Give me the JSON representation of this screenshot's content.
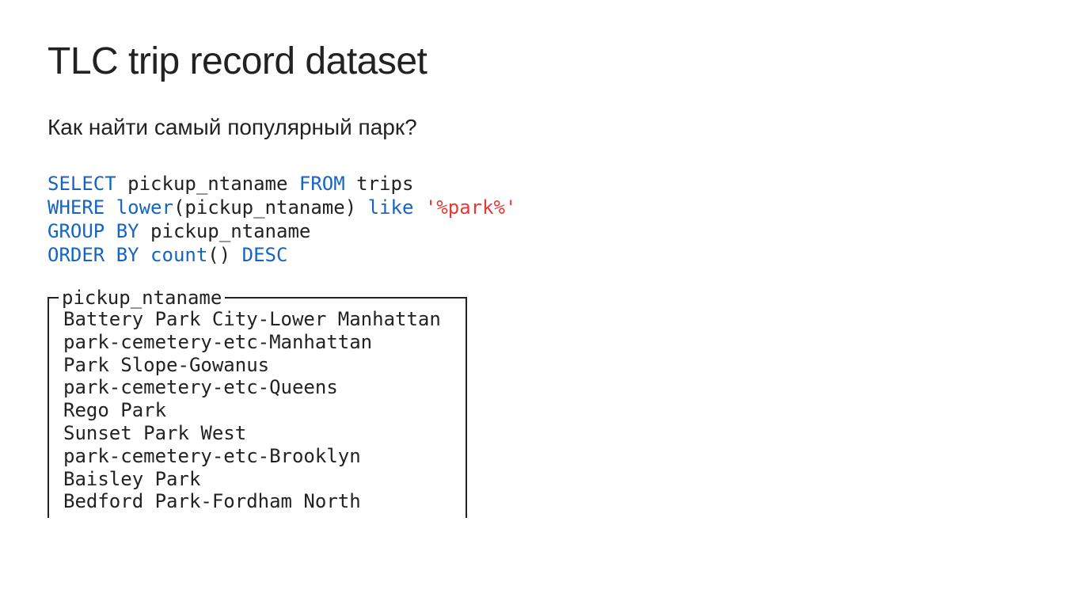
{
  "title": "TLC trip record dataset",
  "subtitle": "Как найти самый популярный парк?",
  "sql": {
    "select": "SELECT",
    "col": "pickup_ntaname",
    "from": "FROM",
    "table": "trips",
    "where": "WHERE",
    "lower": "lower",
    "arg": "(pickup_ntaname)",
    "like": "like",
    "pattern": "'%park%'",
    "groupby": "GROUP BY",
    "groupcol": "pickup_ntaname",
    "orderby": "ORDER BY",
    "count": "count",
    "parens": "()",
    "desc": "DESC"
  },
  "output": {
    "header": "pickup_ntaname",
    "rows": [
      "Battery Park City-Lower Manhattan",
      "park-cemetery-etc-Manhattan",
      "Park Slope-Gowanus",
      "park-cemetery-etc-Queens",
      "Rego Park",
      "Sunset Park West",
      "park-cemetery-etc-Brooklyn",
      "Baisley Park",
      "Bedford Park-Fordham North"
    ]
  }
}
